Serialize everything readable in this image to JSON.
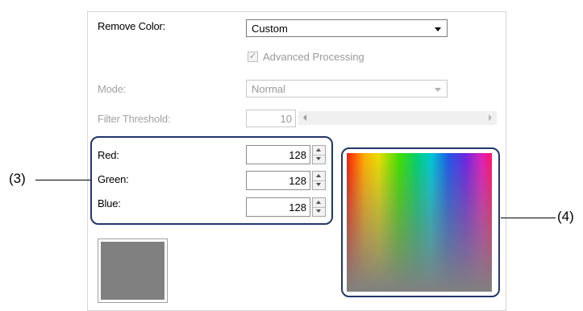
{
  "remove_color": {
    "label": "Remove Color:",
    "value": "Custom"
  },
  "advanced_processing": {
    "label": "Advanced Processing",
    "checked": true,
    "enabled": false
  },
  "mode": {
    "label": "Mode:",
    "value": "Normal",
    "enabled": false
  },
  "filter_threshold": {
    "label": "Filter Threshold:",
    "value": "10",
    "enabled": false
  },
  "rgb": {
    "red": {
      "label": "Red:",
      "value": "128"
    },
    "green": {
      "label": "Green:",
      "value": "128"
    },
    "blue": {
      "label": "Blue:",
      "value": "128"
    }
  },
  "swatch": {
    "color": "#808080"
  },
  "callouts": {
    "left": "(3)",
    "right": "(4)"
  },
  "icons": {
    "check": "checkmark-icon",
    "dropdown": "chevron-down-icon",
    "spin_up": "spin-up-icon",
    "spin_down": "spin-down-icon"
  }
}
